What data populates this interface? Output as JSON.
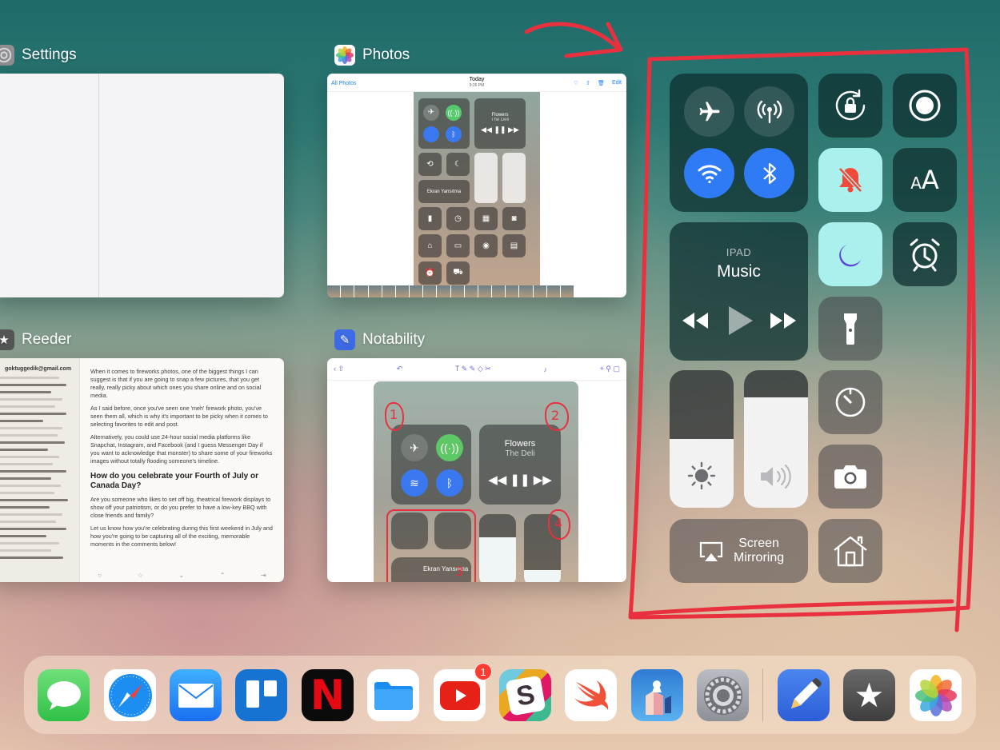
{
  "switcher": {
    "settings": {
      "label": "Settings",
      "icon": "settings-gear-icon"
    },
    "photos": {
      "label": "Photos",
      "icon": "photos-pinwheel-icon",
      "toolbar_back": "All Photos",
      "toolbar_title": "Today",
      "toolbar_time": "9:26 PM",
      "toolbar_edit": "Edit",
      "preview": {
        "music_title": "Flowers",
        "music_artist": "The Deli",
        "mirroring": "Ekran Yansıtma"
      }
    },
    "reeder": {
      "label": "Reeder",
      "icon": "reeder-star-icon",
      "account": "goktuggedik@gmail.com",
      "article": {
        "p1": "When it comes to fireworks photos, one of the biggest things I can suggest is that if you are going to snap a few pictures, that you get really, really picky about which ones you share online and on social media.",
        "p2": "As I said before, once you've seen one 'meh' firework photo, you've seen them all, which is why it's important to be picky when it comes to selecting favorites to edit and post.",
        "p3": "Alternatively, you could use 24-hour social media platforms like Snapchat, Instagram, and Facebook (and I guess Messenger Day if you want to acknowledge that monster) to share some of your fireworks images without totally flooding someone's timeline.",
        "heading": "How do you celebrate your Fourth of July or Canada Day?",
        "p4": "Are you someone who likes to set off big, theatrical firework displays to show off your patriotism, or do you prefer to have a low-key BBQ with close friends and family?",
        "p5": "Let us know how you're celebrating during this first weekend in July and how you're going to be capturing all of the exciting, memorable moments in the comments below!"
      }
    },
    "notability": {
      "label": "Notability",
      "icon": "notability-pencil-icon",
      "preview": {
        "music_title": "Flowers",
        "music_artist": "The Deli",
        "mirroring": "Ekran Yansıtma",
        "marks": [
          "1",
          "2",
          "4",
          "3"
        ]
      }
    }
  },
  "control_center": {
    "connectivity": {
      "airplane": {
        "icon": "airplane-icon",
        "on": false
      },
      "cellular": {
        "icon": "cellular-antenna-icon",
        "on": false
      },
      "wifi": {
        "icon": "wifi-icon",
        "on": true
      },
      "bluetooth": {
        "icon": "bluetooth-icon",
        "on": true
      }
    },
    "rotation_lock": {
      "icon": "rotation-lock-icon",
      "on": false
    },
    "screen_record": {
      "icon": "screen-record-icon",
      "on": false
    },
    "silent": {
      "icon": "bell-slash-icon",
      "on": true
    },
    "text_size": {
      "label": "AA",
      "icon": "text-size-icon"
    },
    "music": {
      "source": "IPAD",
      "title": "Music"
    },
    "do_not_disturb": {
      "icon": "moon-icon",
      "on": true
    },
    "alarm": {
      "icon": "alarm-clock-icon"
    },
    "flashlight": {
      "icon": "flashlight-icon"
    },
    "brightness": {
      "icon": "sun-icon",
      "level": 0.5
    },
    "volume": {
      "icon": "speaker-icon",
      "level": 0.8
    },
    "timer": {
      "icon": "timer-icon"
    },
    "camera": {
      "icon": "camera-icon"
    },
    "screen_mirroring": {
      "label_line1": "Screen",
      "label_line2": "Mirroring",
      "icon": "airplay-icon"
    },
    "home": {
      "icon": "home-icon"
    }
  },
  "annotation": {
    "color": "#e8303f"
  },
  "dock": {
    "apps": [
      {
        "name": "Messages",
        "icon": "messages-icon"
      },
      {
        "name": "Safari",
        "icon": "safari-compass-icon"
      },
      {
        "name": "Mail",
        "icon": "mail-envelope-icon"
      },
      {
        "name": "Trello",
        "icon": "trello-icon"
      },
      {
        "name": "Netflix",
        "icon": "netflix-icon",
        "glyph": "N"
      },
      {
        "name": "Files",
        "icon": "files-folder-icon"
      },
      {
        "name": "YouTube",
        "icon": "youtube-play-icon",
        "badge": "1"
      },
      {
        "name": "Slack",
        "icon": "slack-icon",
        "glyph": "S"
      },
      {
        "name": "Swift Playgrounds",
        "icon": "swift-icon"
      },
      {
        "name": "Monument Valley",
        "icon": "monument-valley-icon"
      },
      {
        "name": "Settings",
        "icon": "settings-gear-icon"
      },
      {
        "name": "Notability",
        "icon": "notability-pencil-icon"
      },
      {
        "name": "Reeder",
        "icon": "reeder-star-icon",
        "glyph": "★"
      },
      {
        "name": "Photos",
        "icon": "photos-pinwheel-icon"
      }
    ]
  },
  "colors": {
    "accent_blue": "#2f7af5",
    "active_teal": "#aaf1ee",
    "toggle_green": "#3fc35d"
  }
}
